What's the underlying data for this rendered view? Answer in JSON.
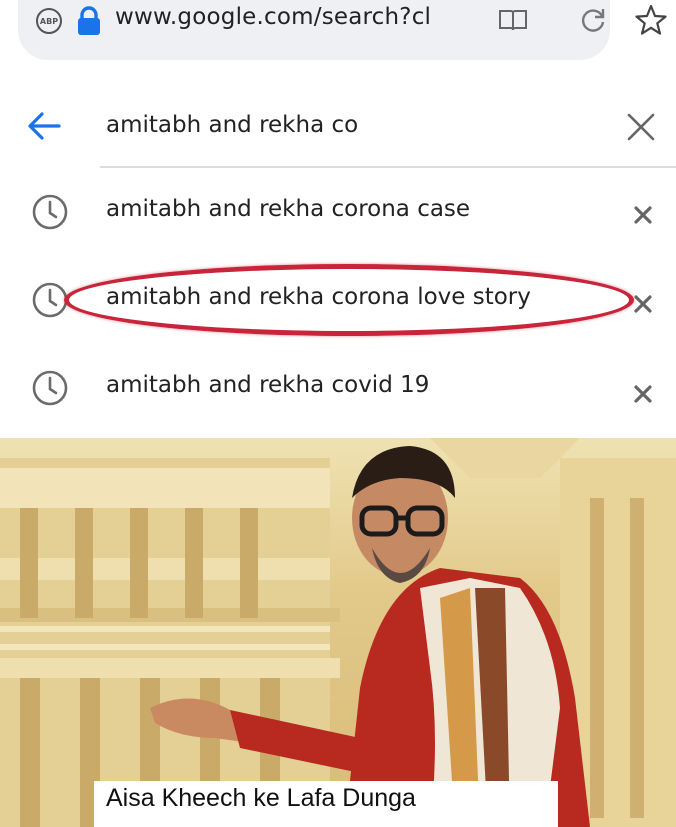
{
  "browser": {
    "url": "www.google.com/search?cl",
    "adblock_badge": "ABP"
  },
  "search": {
    "query": "amitabh and rekha co"
  },
  "suggestions": [
    {
      "label": "amitabh and rekha corona case"
    },
    {
      "label": "amitabh and rekha corona love story"
    },
    {
      "label": "amitabh and rekha covid 19"
    }
  ],
  "meme": {
    "caption": "Aisa Kheech ke Lafa Dunga"
  },
  "colors": {
    "accent": "#1a73e8",
    "highlight": "#c8243a",
    "icon_gray": "#6b6b6b"
  }
}
